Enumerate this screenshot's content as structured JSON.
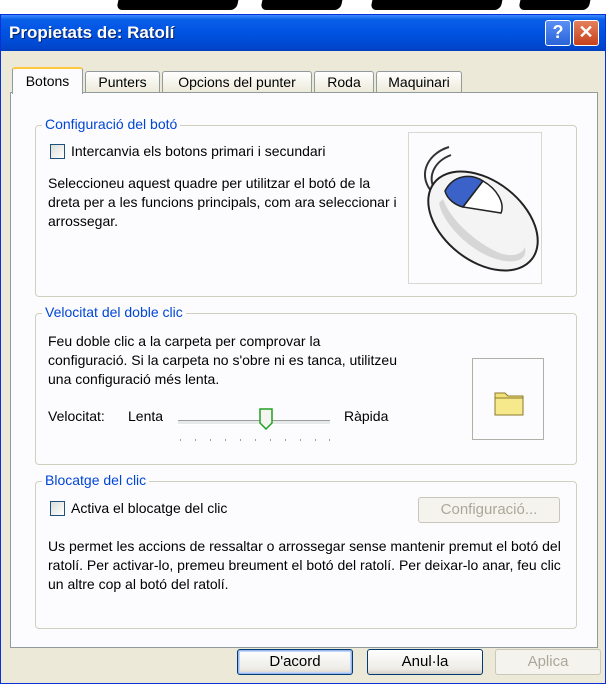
{
  "window": {
    "title": "Propietats de: Ratolí"
  },
  "tabs": [
    {
      "label": "Botons",
      "active": true
    },
    {
      "label": "Punters"
    },
    {
      "label": "Opcions del punter"
    },
    {
      "label": "Roda"
    },
    {
      "label": "Maquinari"
    }
  ],
  "button_config": {
    "legend": "Configuració del botó",
    "swap_label": "Intercanvia els botons primari i secundari",
    "swap_checked": false,
    "description": "Seleccioneu aquest quadre per utilitzar el botó de la dreta per a les funcions principals, com ara seleccionar i arrossegar."
  },
  "double_click": {
    "legend": "Velocitat del doble clic",
    "description": "Feu doble clic a la carpeta per comprovar la configuració. Si la carpeta no s'obre ni es tanca, utilitzeu una configuració més lenta.",
    "speed_label": "Velocitat:",
    "slow_label": "Lenta",
    "fast_label": "Ràpida",
    "speed_value": 0.57
  },
  "click_lock": {
    "legend": "Blocatge del clic",
    "checkbox_label": "Activa el blocatge del clic",
    "checked": false,
    "settings_button": "Configuració...",
    "description": "Us permet les accions de ressaltar o arrossegar sense mantenir premut el botó del ratolí. Per activar-lo, premeu breument el botó del ratolí. Per deixar-lo anar, feu clic un altre cop al botó del ratolí."
  },
  "footer": {
    "ok": "D'acord",
    "cancel": "Anul·la",
    "apply": "Aplica"
  },
  "colors": {
    "titlebar": "#0054e3",
    "legend": "#0046d5",
    "panel": "#fcfcfe",
    "dialog": "#ece9d8"
  },
  "icons": {
    "help": "question-mark",
    "close": "x-mark"
  }
}
